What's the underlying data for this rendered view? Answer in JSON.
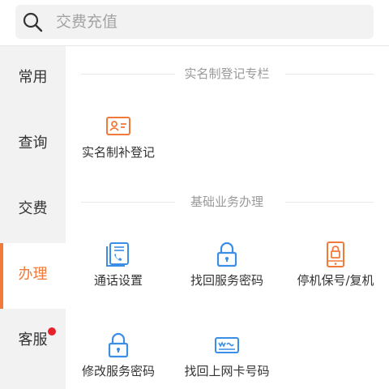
{
  "search": {
    "placeholder": "交费充值"
  },
  "sidebar": {
    "items": [
      {
        "label": "常用"
      },
      {
        "label": "查询"
      },
      {
        "label": "交费"
      },
      {
        "label": "办理",
        "active": true
      },
      {
        "label": "客服",
        "badge": true
      }
    ]
  },
  "sections": [
    {
      "title": "实名制登记专栏",
      "tiles": [
        {
          "label": "实名制补登记",
          "icon": "id-card-icon"
        }
      ]
    },
    {
      "title": "基础业务办理",
      "tiles": [
        {
          "label": "通话设置",
          "icon": "call-settings-icon"
        },
        {
          "label": "找回服务密码",
          "icon": "lock-icon"
        },
        {
          "label": "停机保号/复机",
          "icon": "phone-lock-icon"
        },
        {
          "label": "修改服务密码",
          "icon": "lock-icon"
        },
        {
          "label": "找回上网卡号码",
          "icon": "sim-card-icon"
        }
      ]
    }
  ],
  "colors": {
    "accent": "#f07a3a",
    "icon_blue": "#3a8ee6",
    "badge_red": "#e6212a"
  }
}
